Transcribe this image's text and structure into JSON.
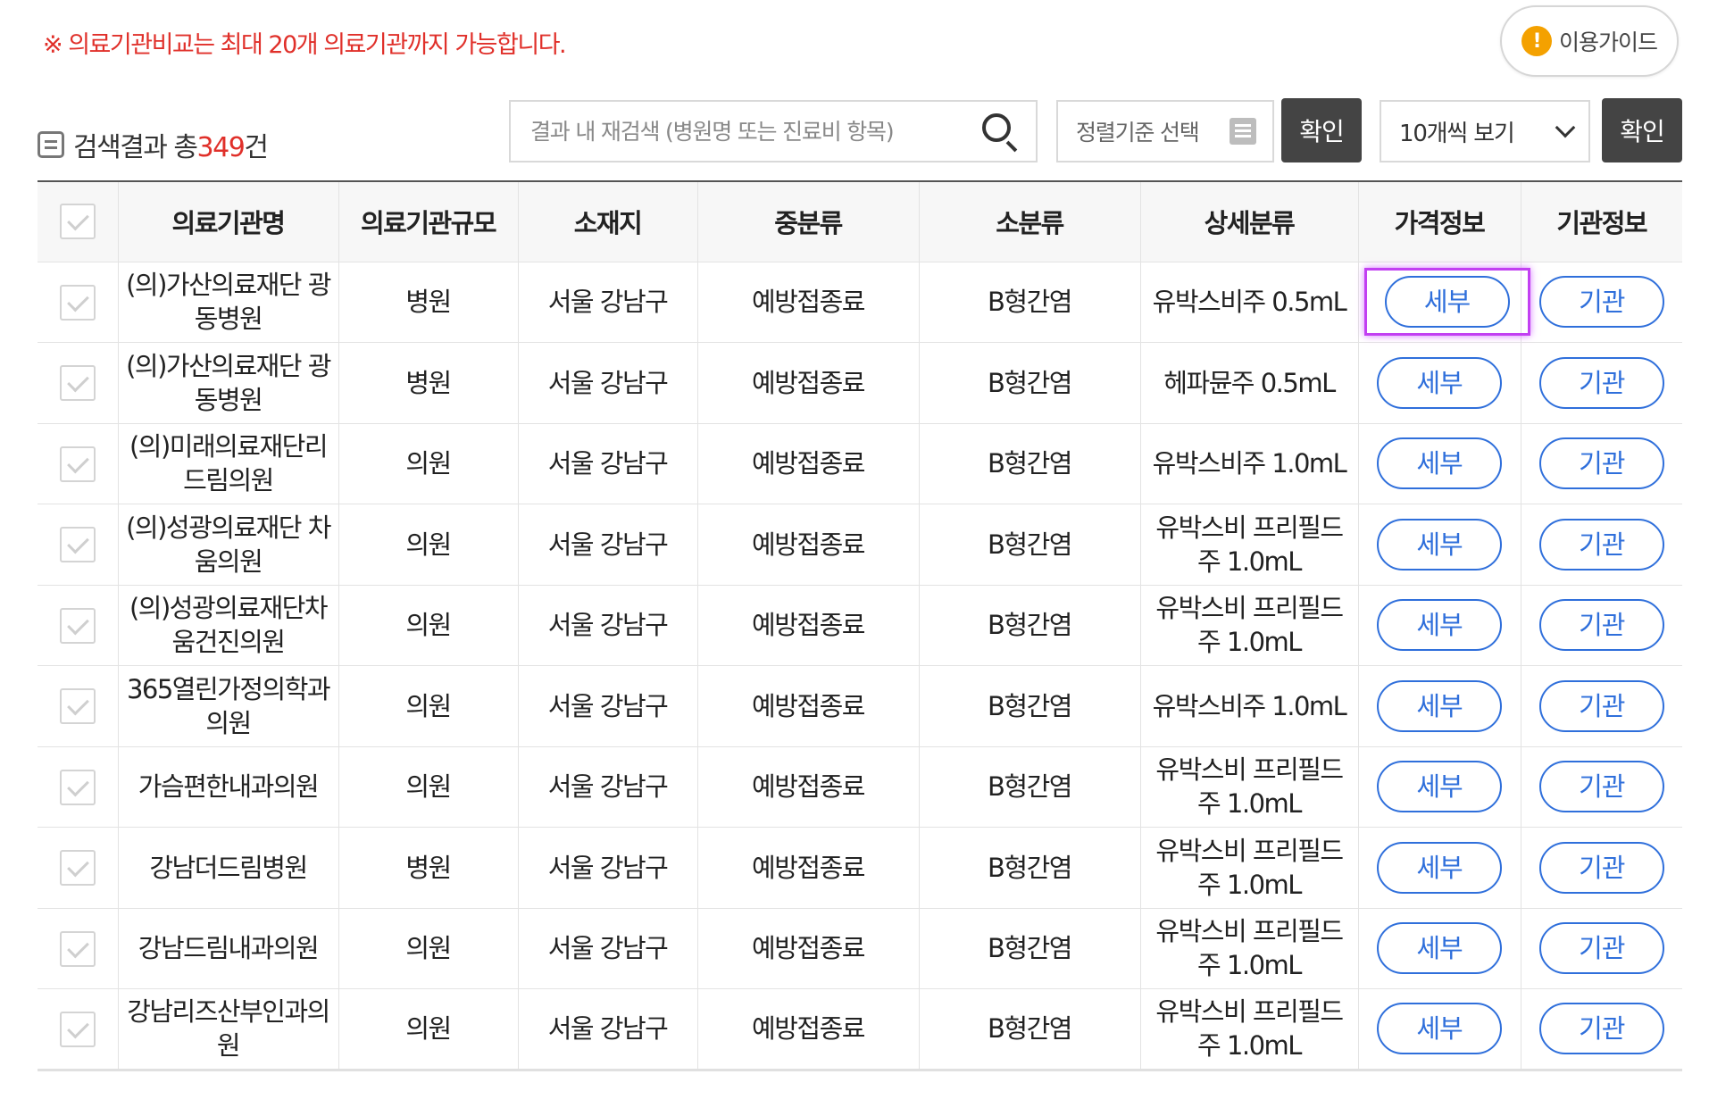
{
  "notice": "※ 의료기관비교는 최대 20개 의료기관까지 가능합니다.",
  "guide_button": {
    "label": "이용가이드",
    "icon": "!"
  },
  "result": {
    "prefix": "검색결과 총",
    "count": "349",
    "suffix": "건"
  },
  "search": {
    "placeholder": "결과 내 재검색 (병원명 또는 진료비 항목)",
    "value": ""
  },
  "sort": {
    "label": "정렬기준 선택"
  },
  "confirm_label": "확인",
  "page_size": {
    "selected": "10개씩 보기"
  },
  "colors": {
    "accent_red": "#e0302a",
    "button_blue": "#2f6fdb",
    "dark_button": "#444444",
    "focus_outline": "#c23ff2"
  },
  "table": {
    "headers": [
      "의료기관명",
      "의료기관규모",
      "소재지",
      "중분류",
      "소분류",
      "상세분류",
      "가격정보",
      "기관정보"
    ],
    "detail_button": "세부",
    "institution_button": "기관",
    "rows": [
      {
        "name": "(의)가산의료재단 광동병원",
        "size": "병원",
        "location": "서울 강남구",
        "mid": "예방접종료",
        "small": "B형간염",
        "detail": "유박스비주 0.5mL"
      },
      {
        "name": "(의)가산의료재단 광동병원",
        "size": "병원",
        "location": "서울 강남구",
        "mid": "예방접종료",
        "small": "B형간염",
        "detail": "헤파뮨주 0.5mL"
      },
      {
        "name": "(의)미래의료재단리드림의원",
        "size": "의원",
        "location": "서울 강남구",
        "mid": "예방접종료",
        "small": "B형간염",
        "detail": "유박스비주 1.0mL"
      },
      {
        "name": "(의)성광의료재단 차움의원",
        "size": "의원",
        "location": "서울 강남구",
        "mid": "예방접종료",
        "small": "B형간염",
        "detail": "유박스비 프리필드주 1.0mL"
      },
      {
        "name": "(의)성광의료재단차움건진의원",
        "size": "의원",
        "location": "서울 강남구",
        "mid": "예방접종료",
        "small": "B형간염",
        "detail": "유박스비 프리필드주 1.0mL"
      },
      {
        "name": "365열린가정의학과의원",
        "size": "의원",
        "location": "서울 강남구",
        "mid": "예방접종료",
        "small": "B형간염",
        "detail": "유박스비주 1.0mL"
      },
      {
        "name": "가슴편한내과의원",
        "size": "의원",
        "location": "서울 강남구",
        "mid": "예방접종료",
        "small": "B형간염",
        "detail": "유박스비 프리필드주 1.0mL"
      },
      {
        "name": "강남더드림병원",
        "size": "병원",
        "location": "서울 강남구",
        "mid": "예방접종료",
        "small": "B형간염",
        "detail": "유박스비 프리필드주 1.0mL"
      },
      {
        "name": "강남드림내과의원",
        "size": "의원",
        "location": "서울 강남구",
        "mid": "예방접종료",
        "small": "B형간염",
        "detail": "유박스비 프리필드주 1.0mL"
      },
      {
        "name": "강남리즈산부인과의원",
        "size": "의원",
        "location": "서울 강남구",
        "mid": "예방접종료",
        "small": "B형간염",
        "detail": "유박스비 프리필드주 1.0mL"
      }
    ]
  }
}
